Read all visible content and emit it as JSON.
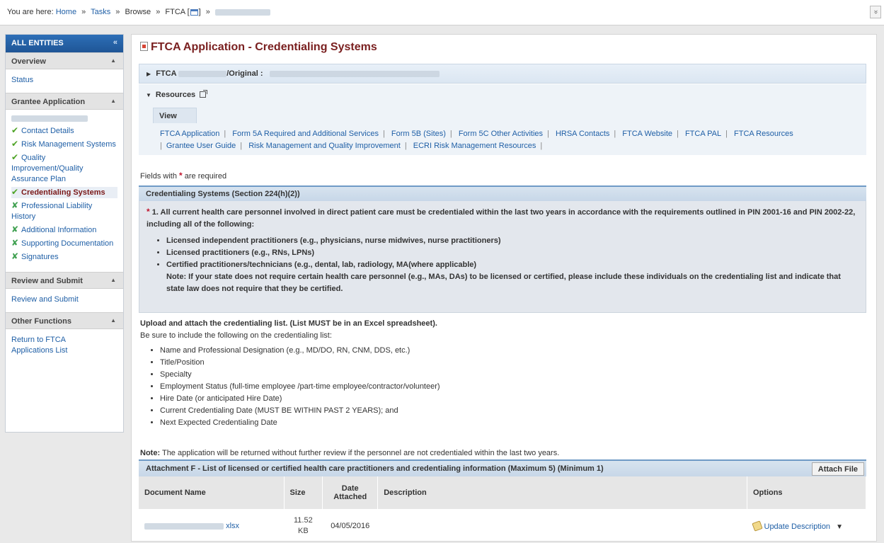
{
  "breadcrumb": {
    "prefix": "You are here:",
    "home": "Home",
    "tasks": "Tasks",
    "browse": "Browse",
    "ftca": "FTCA [",
    "ftca_close": "]",
    "sep": "»",
    "collapse": "»"
  },
  "sidebar": {
    "header": "ALL ENTITIES",
    "collapse": "«",
    "sections": {
      "overview": {
        "title": "Overview",
        "items": {
          "status": "Status"
        }
      },
      "grantee": {
        "title": "Grantee Application",
        "items": {
          "contact": "Contact Details",
          "risk": "Risk Management Systems",
          "quality": "Quality Improvement/Quality Assurance Plan",
          "credentialing": "Credentialing Systems",
          "liability": "Professional Liability History",
          "additional": "Additional Information",
          "supporting": "Supporting Documentation",
          "signatures": "Signatures"
        }
      },
      "review": {
        "title": "Review and Submit",
        "items": {
          "review": "Review and Submit"
        }
      },
      "other": {
        "title": "Other Functions",
        "items": {
          "return": "Return to FTCA Applications List"
        }
      }
    }
  },
  "main": {
    "title": "FTCA Application - Credentialing Systems",
    "ftca_bar": {
      "prefix": "FTCA",
      "original": "/Original :"
    },
    "resources": {
      "title": "Resources",
      "tab": "View",
      "links": [
        "FTCA Application",
        "Form 5A Required and Additional Services",
        "Form 5B (Sites)",
        "Form 5C Other Activities",
        "HRSA Contacts",
        "FTCA Website",
        "FTCA PAL",
        "FTCA Resources",
        "Grantee User Guide",
        "Risk Management and Quality Improvement",
        "ECRI Risk Management Resources"
      ]
    },
    "fields_note": {
      "before": "Fields with",
      "star": "*",
      "after": "are required"
    },
    "credentialing": {
      "header": "Credentialing Systems (Section 224(h)(2))",
      "star": "*",
      "question": "1. All current health care personnel involved in direct patient care must be credentialed within the last two years in accordance with the requirements outlined in PIN 2001-16 and PIN 2002-22, including all of the following:",
      "bullets": [
        "Licensed independent practitioners (e.g., physicians, nurse midwives, nurse practitioners)",
        "Licensed practitioners (e.g., RNs, LPNs)",
        "Certified practitioners/technicians (e.g., dental, lab, radiology, MA(where applicable)"
      ],
      "note": "Note: If your state does not require certain health care personnel (e.g., MAs, DAs) to be licensed or certified, please include these individuals on the credentialing list and indicate that state law does not require that they be certified."
    },
    "upload": {
      "heading": "Upload and attach the credentialing list. (List MUST be in an Excel spreadsheet).",
      "sub": "Be sure to include the following on the credentialing list:",
      "items": [
        "Name and Professional Designation (e.g., MD/DO, RN, CNM, DDS, etc.)",
        "Title/Position",
        "Specialty",
        "Employment Status (full-time employee /part-time employee/contractor/volunteer)",
        "Hire Date (or anticipated Hire Date)",
        "Current Credentialing Date (MUST BE WITHIN PAST 2 YEARS); and",
        "Next Expected Credentialing Date"
      ]
    },
    "return_note": {
      "label": "Note:",
      "text": "The application will be returned without further review if the personnel are not credentialed within the last two years."
    },
    "attachment": {
      "header": "Attachment F - List of licensed or certified health care practitioners and credentialing information (Maximum 5) (Minimum 1)",
      "attach_button": "Attach File",
      "columns": {
        "name": "Document Name",
        "size": "Size",
        "date": "Date Attached",
        "desc": "Description",
        "options": "Options"
      },
      "rows": [
        {
          "name_ext": "xlsx",
          "size": "11.52 KB",
          "date": "04/05/2016",
          "desc": "",
          "action": "Update Description"
        }
      ]
    }
  }
}
